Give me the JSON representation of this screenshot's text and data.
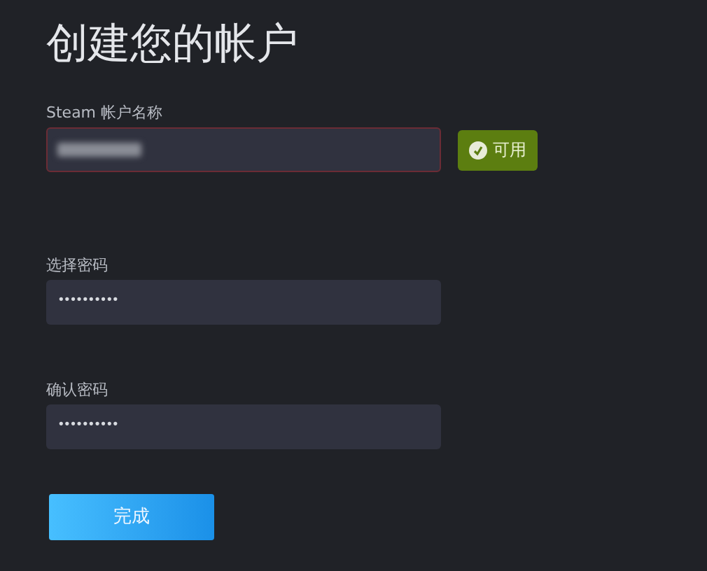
{
  "title": "创建您的帐户",
  "fields": [
    {
      "label": "Steam 帐户名称",
      "value_blurred": true,
      "error": true,
      "badge": {
        "text": "可用"
      }
    },
    {
      "label": "选择密码",
      "value": "••••••••••",
      "value_blurred": false,
      "error": false
    },
    {
      "label": "确认密码",
      "value": "••••••••••",
      "value_blurred": false,
      "error": false
    }
  ],
  "submit": "完成"
}
